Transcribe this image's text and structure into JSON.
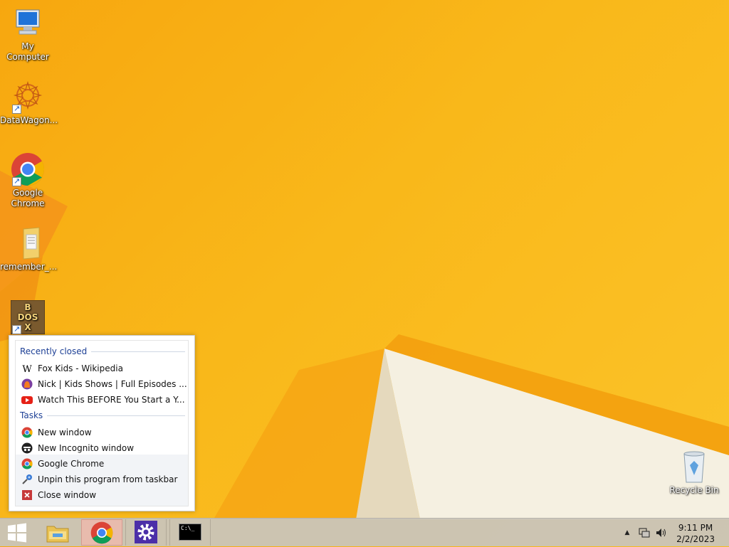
{
  "desktop": {
    "icons": [
      {
        "label": "My Computer",
        "icon": "computer-icon"
      },
      {
        "label": "DataWagon...",
        "icon": "datawagon-icon"
      },
      {
        "label": "Google Chrome",
        "icon": "chrome-icon"
      },
      {
        "label": "remember_...",
        "icon": "folder-icon"
      },
      {
        "label": "",
        "icon": "dosbox-icon"
      },
      {
        "label": "Recycle Bin",
        "icon": "recycle-bin-icon"
      }
    ]
  },
  "jumplist": {
    "recently_closed_header": "Recently closed",
    "recent": [
      {
        "label": "Fox Kids - Wikipedia",
        "icon": "wikipedia-icon"
      },
      {
        "label": "Nick | Kids Shows | Full Episodes ...",
        "icon": "nick-icon"
      },
      {
        "label": "Watch This BEFORE You Start a Y...",
        "icon": "youtube-icon"
      }
    ],
    "tasks_header": "Tasks",
    "tasks": [
      {
        "label": "New window",
        "icon": "chrome-icon"
      },
      {
        "label": "New Incognito window",
        "icon": "incognito-icon"
      }
    ],
    "app_actions": [
      {
        "label": "Google Chrome",
        "icon": "chrome-icon"
      },
      {
        "label": "Unpin this program from taskbar",
        "icon": "unpin-icon"
      },
      {
        "label": "Close window",
        "icon": "close-icon"
      }
    ]
  },
  "taskbar": {
    "items": [
      {
        "name": "start-button",
        "icon": "windows-logo-icon"
      },
      {
        "name": "file-explorer",
        "icon": "folder-icon"
      },
      {
        "name": "chrome",
        "icon": "chrome-icon",
        "active": true
      },
      {
        "name": "settings",
        "icon": "gear-icon"
      },
      {
        "name": "command-prompt",
        "icon": "cmd-icon",
        "text": "C:\\_"
      }
    ],
    "clock": {
      "time": "9:11 PM",
      "date": "2/2/2023"
    }
  },
  "colors": {
    "wallpaper": "#f9b81a",
    "jumplist_header": "#1c3f95",
    "taskbar": "#c8c4be",
    "active_task": "#f5b4aa"
  }
}
